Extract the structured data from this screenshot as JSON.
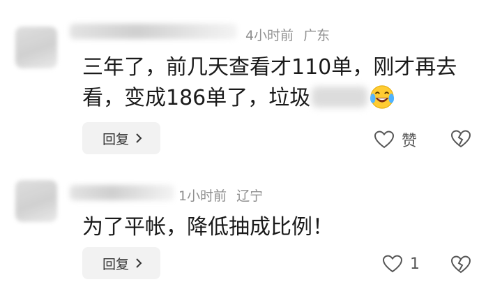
{
  "comments": [
    {
      "time": "4小时前",
      "location": "广东",
      "text_line1": "三年了，前几天查看才110单，刚才再去",
      "text_line2_before": "看，变成186单了，垃圾",
      "reply_label": "回复",
      "like_label": "赞",
      "emoji": "laughing-crying-emoji"
    },
    {
      "time": "1小时前",
      "location": "辽宁",
      "text": "为了平帐，降低抽成比例！",
      "reply_label": "回复",
      "like_count": "1"
    }
  ],
  "colors": {
    "text": "#1a1a1a",
    "meta": "#8f8f8f",
    "reply_bg": "#f2f2f2",
    "icon": "#555555"
  }
}
